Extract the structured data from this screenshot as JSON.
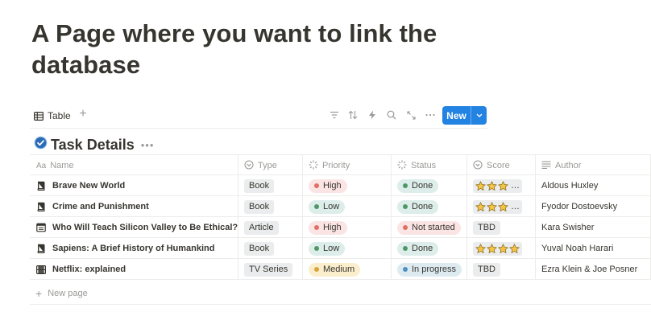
{
  "page": {
    "title": "A Page where you want to link the database"
  },
  "view_bar": {
    "tab_label": "Table",
    "add_view": "+",
    "new_label": "New",
    "tool_icons": [
      "filter-icon",
      "sort-icon",
      "automation-icon",
      "search-icon",
      "expand-icon",
      "more-icon"
    ]
  },
  "database": {
    "title": "Task Details",
    "more": "•••"
  },
  "columns": [
    "Name",
    "Type",
    "Priority",
    "Status",
    "Score",
    "Author"
  ],
  "rows": [
    {
      "name": "Brave New World",
      "icon": "book-icon",
      "type": "Book",
      "priority": "High",
      "status": "Done",
      "score_stars": 3,
      "score_text": "",
      "score_overflow": "…",
      "author": "Aldous Huxley"
    },
    {
      "name": "Crime and Punishment",
      "icon": "book-icon",
      "type": "Book",
      "priority": "Low",
      "status": "Done",
      "score_stars": 3,
      "score_text": "",
      "score_overflow": "…",
      "author": "Fyodor Dostoevsky"
    },
    {
      "name": "Who Will Teach Silicon Valley to Be Ethical?",
      "icon": "article-icon",
      "type": "Article",
      "priority": "High",
      "status": "Not started",
      "score_stars": 0,
      "score_text": "TBD",
      "score_overflow": "",
      "author": "Kara Swisher"
    },
    {
      "name": "Sapiens: A Brief History of Humankind",
      "icon": "book-icon",
      "type": "Book",
      "priority": "Low",
      "status": "Done",
      "score_stars": 4,
      "score_text": "",
      "score_overflow": "",
      "author": "Yuval Noah Harari"
    },
    {
      "name": "Netflix: explained",
      "icon": "film-icon",
      "type": "TV Series",
      "priority": "Medium",
      "status": "In progress",
      "score_stars": 0,
      "score_text": "TBD",
      "score_overflow": "",
      "author": "Ezra Klein & Joe Posner"
    }
  ],
  "priority_colors": {
    "High": {
      "bg": "#fbe4e4",
      "dot": "#e16f64"
    },
    "Low": {
      "bg": "#ddedea",
      "dot": "#4f9768"
    },
    "Medium": {
      "bg": "#fbeecc",
      "dot": "#d9a43b"
    }
  },
  "status_colors": {
    "Done": {
      "bg": "#ddedea",
      "dot": "#4f9768"
    },
    "Not started": {
      "bg": "#fbe4e4",
      "dot": "#e16f64"
    },
    "In progress": {
      "bg": "#ddebf1",
      "dot": "#4a90c2"
    }
  },
  "accent": "#2383e2",
  "new_page_label": "New page"
}
